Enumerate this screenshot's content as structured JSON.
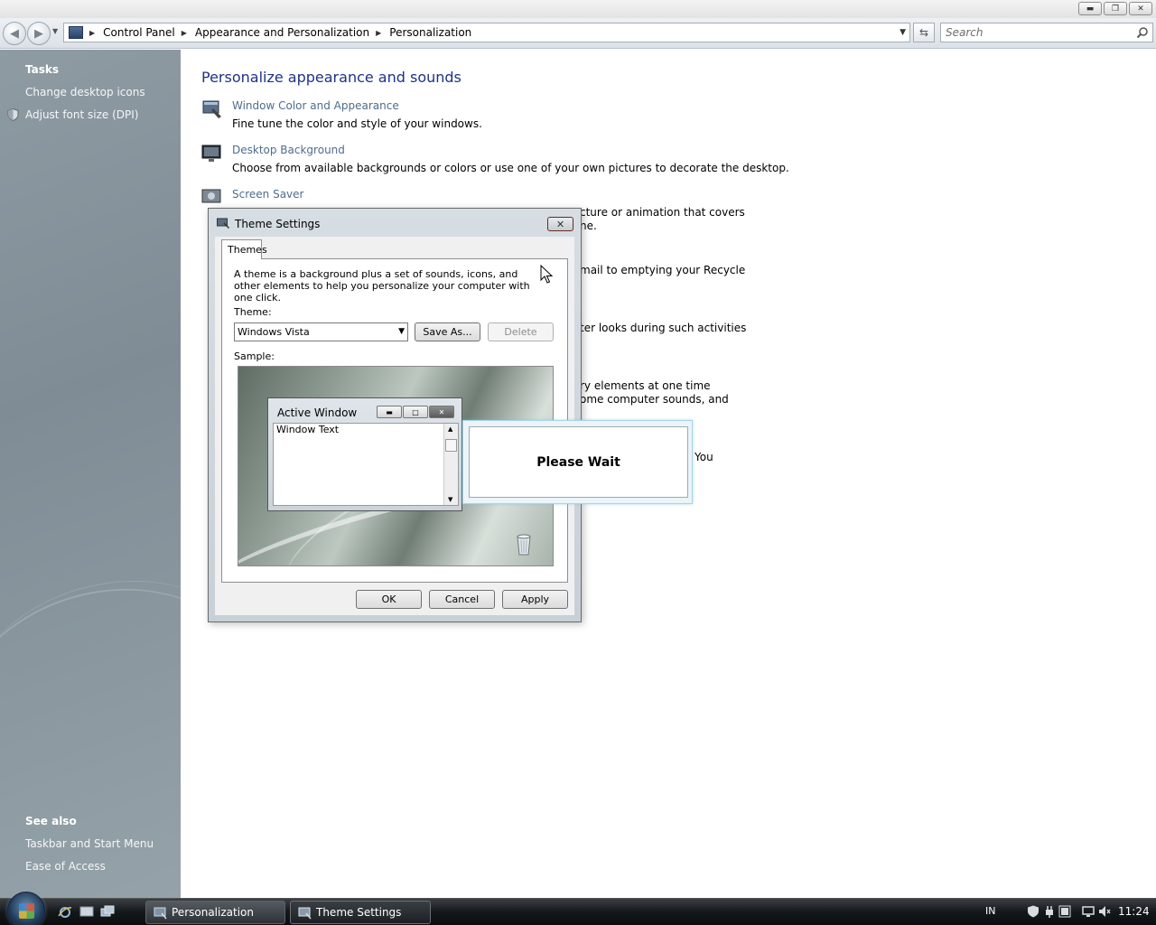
{
  "window": {
    "caption_buttons": [
      "minimize",
      "restore",
      "close"
    ]
  },
  "address_bar": {
    "breadcrumbs": [
      "Control Panel",
      "Appearance and Personalization",
      "Personalization"
    ],
    "search_placeholder": "Search"
  },
  "sidebar": {
    "tasks_heading": "Tasks",
    "tasks": [
      {
        "label": "Change desktop icons",
        "icon": ""
      },
      {
        "label": "Adjust font size (DPI)",
        "icon": "shield-icon"
      }
    ],
    "see_also_heading": "See also",
    "see_also": [
      {
        "label": "Taskbar and Start Menu"
      },
      {
        "label": "Ease of Access"
      }
    ]
  },
  "main": {
    "title": "Personalize appearance and sounds",
    "items": [
      {
        "link": "Window Color and Appearance",
        "desc": "Fine tune the color and style of your windows."
      },
      {
        "link": "Desktop Background",
        "desc": "Choose from available backgrounds or colors or use one of your own pictures to decorate the desktop."
      },
      {
        "link": "Screen Saver",
        "desc": ""
      }
    ],
    "fragments": [
      "cture or animation that covers",
      "ne.",
      "mail to emptying your Recycle",
      "ter looks during such activities",
      "ry elements at one time",
      "ome computer sounds, and",
      "You"
    ]
  },
  "dialog": {
    "title": "Theme Settings",
    "tab": "Themes",
    "description": "A theme is a background plus a set of sounds, icons, and other elements to help you personalize your computer with one click.",
    "theme_label": "Theme:",
    "theme_value": "Windows Vista",
    "save_as": "Save As...",
    "delete": "Delete",
    "sample_label": "Sample:",
    "sample_window_title": "Active Window",
    "sample_window_text": "Window Text",
    "ok": "OK",
    "cancel": "Cancel",
    "apply": "Apply"
  },
  "please_wait": {
    "text": "Please Wait"
  },
  "taskbar": {
    "tasks": [
      {
        "label": "Personalization"
      },
      {
        "label": "Theme Settings"
      }
    ],
    "language": "IN",
    "clock": "11:24"
  }
}
